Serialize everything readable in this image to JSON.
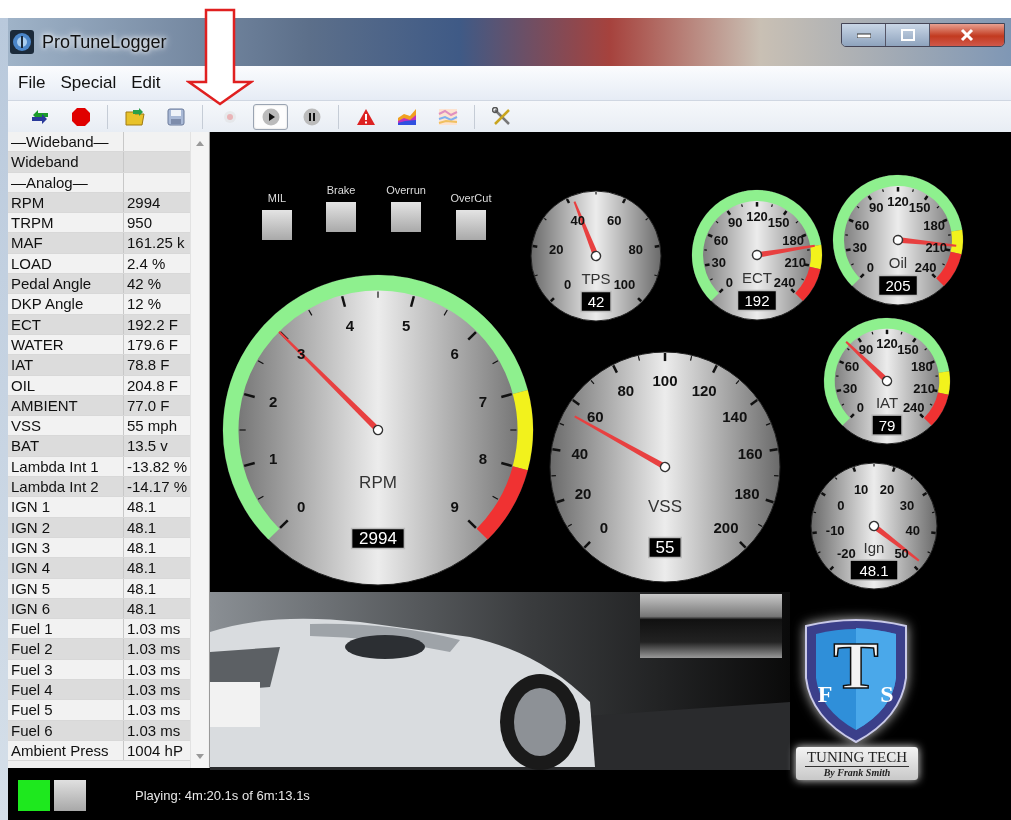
{
  "window": {
    "title": "ProTuneLogger"
  },
  "menu": [
    "File",
    "Special",
    "Edit"
  ],
  "toolbar_groups": [
    {
      "buttons": [
        {
          "kind": "connect",
          "disabled": false,
          "pressed": false
        },
        {
          "kind": "stop",
          "disabled": false,
          "pressed": false
        }
      ]
    },
    {
      "buttons": [
        {
          "kind": "open",
          "disabled": false,
          "pressed": false
        },
        {
          "kind": "save",
          "disabled": false,
          "pressed": false
        }
      ]
    },
    {
      "buttons": [
        {
          "kind": "record",
          "disabled": true,
          "pressed": false
        },
        {
          "kind": "play",
          "disabled": false,
          "pressed": true
        },
        {
          "kind": "pause",
          "disabled": false,
          "pressed": false
        }
      ]
    },
    {
      "buttons": [
        {
          "kind": "alert",
          "disabled": false,
          "pressed": false
        },
        {
          "kind": "chart",
          "disabled": false,
          "pressed": false
        },
        {
          "kind": "chart_light",
          "disabled": false,
          "pressed": false
        }
      ]
    },
    {
      "buttons": [
        {
          "kind": "tools",
          "disabled": false,
          "pressed": false
        }
      ]
    }
  ],
  "channels": [
    {
      "kind": "header",
      "name": "—Wideband—"
    },
    {
      "kind": "row",
      "name": "Wideband"
    },
    {
      "kind": "header",
      "name": "—Analog—"
    },
    {
      "kind": "row",
      "name": "RPM",
      "value": "2994"
    },
    {
      "kind": "row",
      "name": "TRPM",
      "value": "950"
    },
    {
      "kind": "row",
      "name": "MAF",
      "value": "161.25 k"
    },
    {
      "kind": "row",
      "name": "LOAD",
      "value": "2.4 %"
    },
    {
      "kind": "row",
      "name": "Pedal Angle",
      "value": "42 %"
    },
    {
      "kind": "row",
      "name": "DKP Angle",
      "value": "12 %"
    },
    {
      "kind": "row",
      "name": "ECT",
      "value": "192.2 F"
    },
    {
      "kind": "row",
      "name": "WATER",
      "value": "179.6 F"
    },
    {
      "kind": "row",
      "name": "IAT",
      "value": "78.8 F"
    },
    {
      "kind": "row",
      "name": "OIL",
      "value": "204.8 F"
    },
    {
      "kind": "row",
      "name": "AMBIENT",
      "value": "77.0 F"
    },
    {
      "kind": "row",
      "name": "VSS",
      "value": "55 mph"
    },
    {
      "kind": "row",
      "name": "BAT",
      "value": "13.5 v"
    },
    {
      "kind": "row",
      "name": "Lambda Int 1",
      "value": "-13.82 %"
    },
    {
      "kind": "row",
      "name": "Lambda Int 2",
      "value": "-14.17 %"
    },
    {
      "kind": "row",
      "name": "IGN 1",
      "value": "48.1"
    },
    {
      "kind": "row",
      "name": "IGN 2",
      "value": "48.1"
    },
    {
      "kind": "row",
      "name": "IGN 3",
      "value": "48.1"
    },
    {
      "kind": "row",
      "name": "IGN 4",
      "value": "48.1"
    },
    {
      "kind": "row",
      "name": "IGN 5",
      "value": "48.1"
    },
    {
      "kind": "row",
      "name": "IGN 6",
      "value": "48.1"
    },
    {
      "kind": "row",
      "name": "Fuel 1",
      "value": "1.03 ms"
    },
    {
      "kind": "row",
      "name": "Fuel 2",
      "value": "1.03 ms"
    },
    {
      "kind": "row",
      "name": "Fuel 3",
      "value": "1.03 ms"
    },
    {
      "kind": "row",
      "name": "Fuel 4",
      "value": "1.03 ms"
    },
    {
      "kind": "row",
      "name": "Fuel 5",
      "value": "1.03 ms"
    },
    {
      "kind": "row",
      "name": "Fuel 6",
      "value": "1.03 ms"
    },
    {
      "kind": "row",
      "name": "Ambient Press",
      "value": "1004 hP"
    }
  ],
  "lamps": [
    {
      "label": "MIL",
      "on": false
    },
    {
      "label": "Brake",
      "on": false
    },
    {
      "label": "Overrun",
      "on": false
    },
    {
      "label": "OverCut",
      "on": false
    }
  ],
  "gauges": [
    {
      "name": "TPS",
      "kind": "plain",
      "readout": "42",
      "scale": [
        "0",
        "20",
        "40",
        "60",
        "80",
        "100"
      ]
    },
    {
      "name": "ECT",
      "kind": "temperature",
      "readout": "192",
      "scale": [
        "0",
        "30",
        "60",
        "90",
        "120",
        "150",
        "180",
        "210",
        "240"
      ]
    },
    {
      "name": "Oil",
      "kind": "temperature",
      "readout": "205",
      "scale": [
        "0",
        "30",
        "60",
        "90",
        "120",
        "150",
        "180",
        "210",
        "240"
      ]
    },
    {
      "name": "RPM",
      "kind": "rpm",
      "readout": "2994",
      "scale": [
        "0",
        "1",
        "2",
        "3",
        "4",
        "5",
        "6",
        "7",
        "8",
        "9"
      ]
    },
    {
      "name": "VSS",
      "kind": "plain",
      "readout": "55",
      "scale": [
        "0",
        "20",
        "40",
        "60",
        "80",
        "100",
        "120",
        "140",
        "160",
        "180",
        "200"
      ]
    },
    {
      "name": "IAT",
      "kind": "temperature",
      "readout": "79",
      "scale": [
        "0",
        "30",
        "60",
        "90",
        "120",
        "150",
        "180",
        "210",
        "240"
      ]
    },
    {
      "name": "Ign",
      "kind": "plain",
      "readout": "48.1",
      "scale": [
        "-20",
        "-10",
        "0",
        "10",
        "20",
        "30",
        "40",
        "50"
      ]
    }
  ],
  "logo": {
    "monogram": [
      "T",
      "F",
      "S"
    ],
    "name": "TUNING TECH",
    "byline": "By Frank Smith"
  },
  "status": {
    "lamps": [
      {
        "on": true
      },
      {
        "on": false
      }
    ],
    "text": "Playing: 4m:20.1s of 6m:13.1s"
  }
}
